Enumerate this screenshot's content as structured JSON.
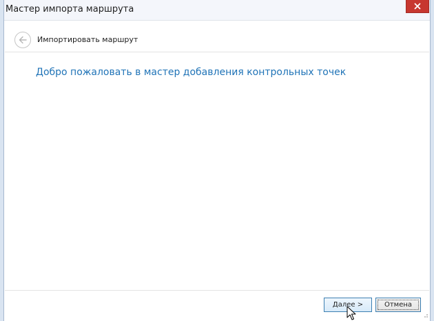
{
  "window": {
    "title": "Мастер импорта маршрута"
  },
  "nav": {
    "title": "Импортировать маршрут"
  },
  "content": {
    "welcome_text": "Добро пожаловать в мастер добавления контрольных точек"
  },
  "footer": {
    "next_label": "Далее >",
    "cancel_label": "Отмена"
  },
  "icons": {
    "close": "close-icon",
    "back": "back-arrow-icon",
    "cursor": "mouse-cursor-icon"
  },
  "colors": {
    "accent_text": "#1f73b7",
    "close_button": "#c7372f",
    "frame": "#d9e4f1"
  }
}
